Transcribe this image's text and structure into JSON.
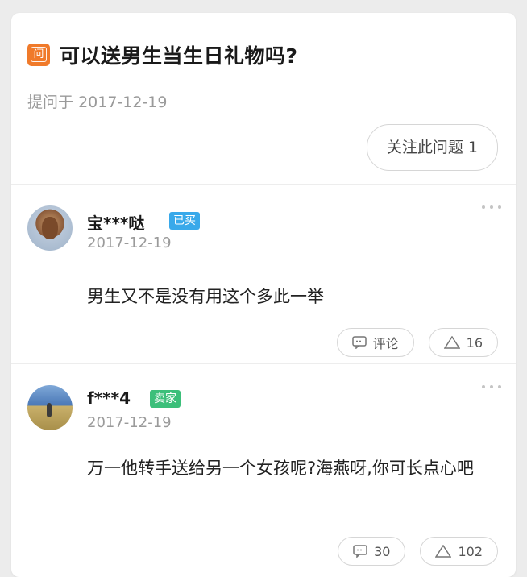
{
  "question": {
    "badge": "问",
    "title": "可以送男生当生日礼物吗?",
    "date_prefix": "提问于",
    "date": "2017-12-19",
    "follow_label": "关注此问题",
    "follow_count": "1"
  },
  "answers": [
    {
      "user": "宝***哒",
      "tag": "已买",
      "date": "2017-12-19",
      "text": "男生又不是没有用这个多此一举",
      "comment_label": "评论",
      "likes": "16"
    },
    {
      "user": "f***4",
      "tag": "卖家",
      "date": "2017-12-19",
      "text": "万一他转手送给另一个女孩呢?海燕呀,你可长点心吧",
      "comment_label": "30",
      "likes": "102"
    }
  ],
  "colors": {
    "badge": "#f07a2a",
    "tag_bought": "#39a9ea",
    "tag_seller": "#3cbf7a"
  },
  "icons": [
    "question-badge-icon",
    "more-icon",
    "comment-icon",
    "like-triangle-icon",
    "avatar-cow",
    "avatar-landscape"
  ]
}
